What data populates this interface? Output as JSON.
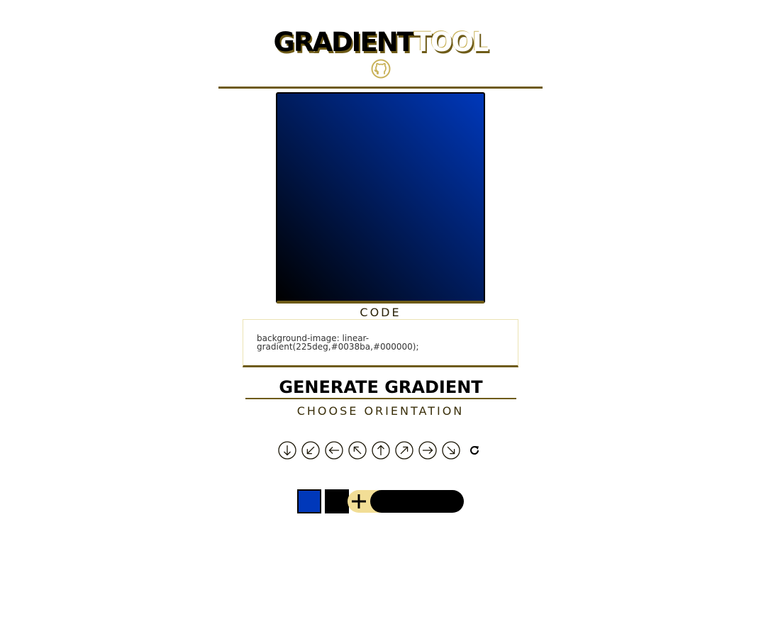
{
  "header": {
    "title_part1": "GRADIENT",
    "title_part2": "TOOL",
    "github_icon": "github-icon"
  },
  "preview": {
    "angle_deg": 225,
    "color_stops": [
      "#0038ba",
      "#000000"
    ]
  },
  "code": {
    "label": "CODE",
    "text": "background-image: linear-gradient(225deg,#0038ba,#000000);"
  },
  "generate": {
    "title": "GENERATE GRADIENT",
    "orientation_label": "CHOOSE ORIENTATION",
    "orientations": [
      {
        "icon": "arrow-down-circle-icon"
      },
      {
        "icon": "arrow-down-left-circle-icon"
      },
      {
        "icon": "arrow-left-circle-icon"
      },
      {
        "icon": "arrow-up-left-circle-icon"
      },
      {
        "icon": "arrow-up-circle-icon"
      },
      {
        "icon": "arrow-up-right-circle-icon"
      },
      {
        "icon": "arrow-right-circle-icon"
      },
      {
        "icon": "arrow-down-right-circle-icon"
      }
    ],
    "refresh_icon": "refresh-icon"
  },
  "colors": {
    "swatches": [
      "#0038ba",
      "#000000"
    ],
    "add_icon": "plus-icon",
    "input_value": ""
  },
  "theme": {
    "accent": "#6e5b17",
    "accent_light": "#f2de96"
  }
}
